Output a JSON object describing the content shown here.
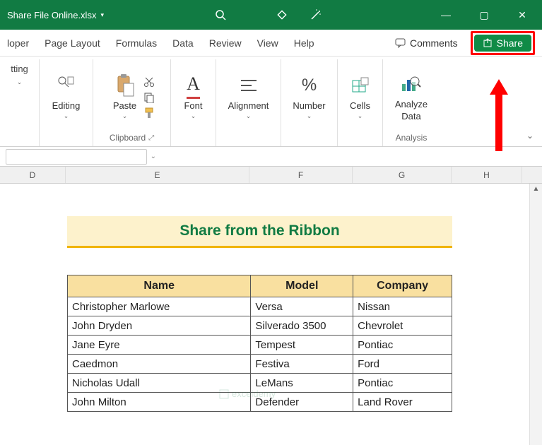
{
  "titlebar": {
    "filename": "Share File Online.xlsx"
  },
  "window_controls": {
    "minimize": "—",
    "maximize": "▢",
    "close": "✕"
  },
  "tabs": [
    "loper",
    "Page Layout",
    "Formulas",
    "Data",
    "Review",
    "View",
    "Help"
  ],
  "right_controls": {
    "comments": "Comments",
    "share": "Share"
  },
  "ribbon": {
    "editing": {
      "label": "Editing",
      "partial": "tting"
    },
    "clipboard": {
      "paste": "Paste",
      "group": "Clipboard"
    },
    "font": {
      "label": "Font"
    },
    "alignment": {
      "label": "Alignment"
    },
    "number": {
      "label": "Number"
    },
    "cells": {
      "label": "Cells"
    },
    "analyze": {
      "line1": "Analyze",
      "line2": "Data",
      "group": "Analysis"
    }
  },
  "columns": [
    "D",
    "E",
    "F",
    "G",
    "H"
  ],
  "sheet_title": "Share from the Ribbon",
  "table": {
    "headers": {
      "name": "Name",
      "model": "Model",
      "company": "Company"
    },
    "rows": [
      {
        "name": "Christopher Marlowe",
        "model": "Versa",
        "company": "Nissan"
      },
      {
        "name": "John Dryden",
        "model": "Silverado 3500",
        "company": "Chevrolet"
      },
      {
        "name": "Jane Eyre",
        "model": "Tempest",
        "company": "Pontiac"
      },
      {
        "name": "Caedmon",
        "model": "Festiva",
        "company": "Ford"
      },
      {
        "name": "Nicholas Udall",
        "model": "LeMans",
        "company": "Pontiac"
      },
      {
        "name": "John Milton",
        "model": "Defender",
        "company": "Land Rover"
      }
    ]
  },
  "watermark": "exceldemy"
}
